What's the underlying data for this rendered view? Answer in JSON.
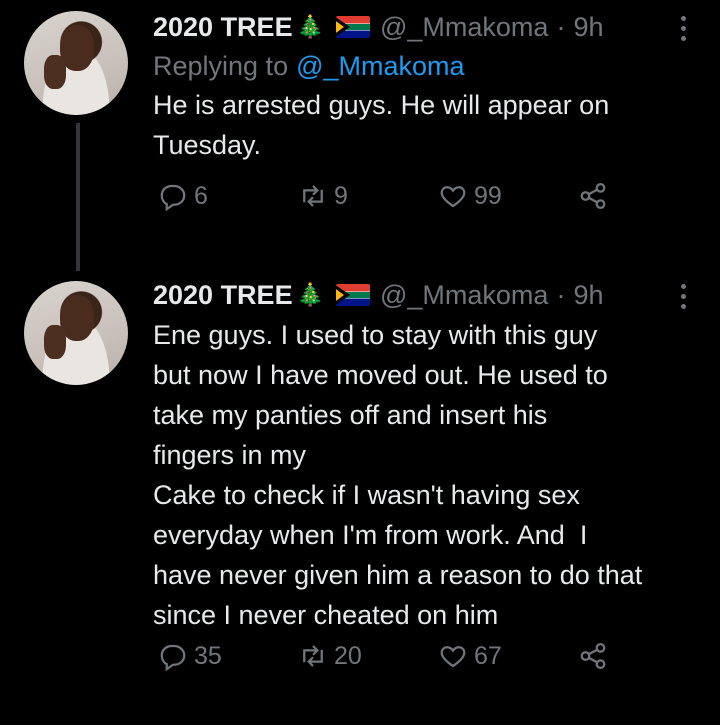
{
  "tweets": [
    {
      "display_name": "2020 TREE",
      "name_emoji": "🎄",
      "handle": "@_Mmakoma",
      "dot": "·",
      "time": "9h",
      "replying_prefix": "Replying to",
      "replying_to": "@_Mmakoma",
      "text": "He is arrested guys. He will appear on\nTuesday.",
      "replies": "6",
      "retweets": "9",
      "likes": "99",
      "icons": [
        "reply-icon",
        "retweet-icon",
        "like-icon",
        "share-icon",
        "more-icon"
      ]
    },
    {
      "display_name": "2020 TREE",
      "name_emoji": "🎄",
      "handle": "@_Mmakoma",
      "dot": "·",
      "time": "9h",
      "text": "Ene guys. I used to stay with this guy\nbut now I have moved out. He used to\ntake my panties off and insert his\nfingers in my\nCake to check if I wasn't having sex\neveryday when I'm from work. And  I\nhave never given him a reason to do that\nsince I never cheated on him",
      "replies": "35",
      "retweets": "20",
      "likes": "67",
      "icons": [
        "reply-icon",
        "retweet-icon",
        "like-icon",
        "share-icon",
        "more-icon"
      ]
    }
  ],
  "colors": {
    "background": "#000000",
    "text": "#e7e9ea",
    "muted": "#71767b",
    "link": "#1d9bf0"
  }
}
